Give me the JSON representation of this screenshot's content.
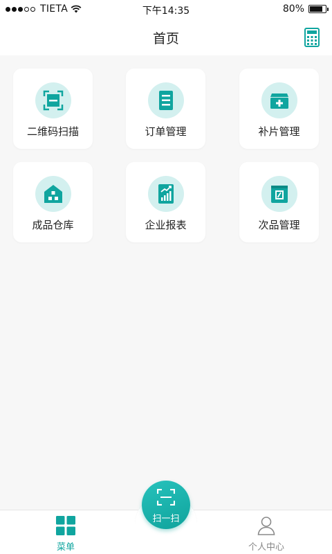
{
  "status_bar": {
    "carrier": "TIETA",
    "time": "下午14:35",
    "battery": "80%",
    "battery_level": 0.8
  },
  "header": {
    "title": "首页",
    "calculator_icon": "calculator-icon"
  },
  "menu_items": [
    {
      "label": "二维码扫描",
      "icon": "qr-scan-icon"
    },
    {
      "label": "订单管理",
      "icon": "order-list-icon"
    },
    {
      "label": "补片管理",
      "icon": "medical-box-icon"
    },
    {
      "label": "成品仓库",
      "icon": "warehouse-icon"
    },
    {
      "label": "企业报表",
      "icon": "report-chart-icon"
    },
    {
      "label": "次品管理",
      "icon": "defect-box-icon"
    }
  ],
  "tab_bar": {
    "menu_label": "菜单",
    "scan_label": "扫一扫",
    "profile_label": "个人中心"
  },
  "colors": {
    "accent": "#10a59f",
    "icon_bg": "#d3f0ef"
  }
}
